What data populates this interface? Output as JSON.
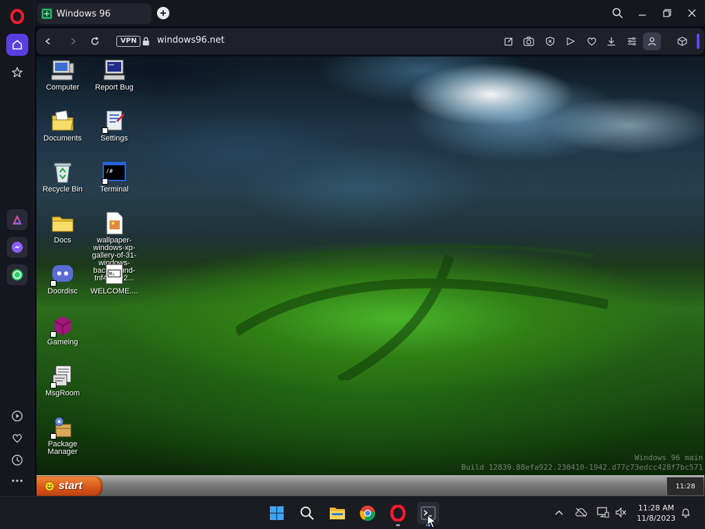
{
  "browser": {
    "tab_title": "Windows 96",
    "vpn_label": "VPN",
    "url": "windows96.net"
  },
  "desktop": {
    "icons": [
      {
        "label": "Computer",
        "icon": "computer-icon"
      },
      {
        "label": "Report Bug",
        "icon": "report-bug-icon"
      },
      {
        "label": "Documents",
        "icon": "documents-icon"
      },
      {
        "label": "Settings",
        "icon": "settings-icon"
      },
      {
        "label": "Recycle Bin",
        "icon": "recycle-bin-icon"
      },
      {
        "label": "Terminal",
        "icon": "terminal-icon"
      },
      {
        "label": "Docs",
        "icon": "folder-icon"
      },
      {
        "label": "wallpaper-windows-xp-gallery-of-31-windows-background-tnf4x2a92...",
        "icon": "image-file-icon"
      },
      {
        "label": "Doordisc",
        "icon": "doordisc-icon"
      },
      {
        "label": "WELCOME....",
        "icon": "markdown-file-icon"
      },
      {
        "label": "Gameing",
        "icon": "game-icon"
      },
      {
        "label": "MsgRoom",
        "icon": "msgroom-icon"
      },
      {
        "label": "Package Manager",
        "icon": "package-manager-icon"
      }
    ],
    "build_line1": "Windows 96 main",
    "build_line2": "Build 12839.88efa922.230410-1942.d77c73edcc428f7bc571"
  },
  "w96_taskbar": {
    "start_label": "start",
    "clock": "11:28"
  },
  "os_taskbar": {
    "time": "11:28 AM",
    "date": "11/8/2023"
  },
  "colors": {
    "opera_accent": "#5a3fe0",
    "start_orange": "#d9571a"
  }
}
